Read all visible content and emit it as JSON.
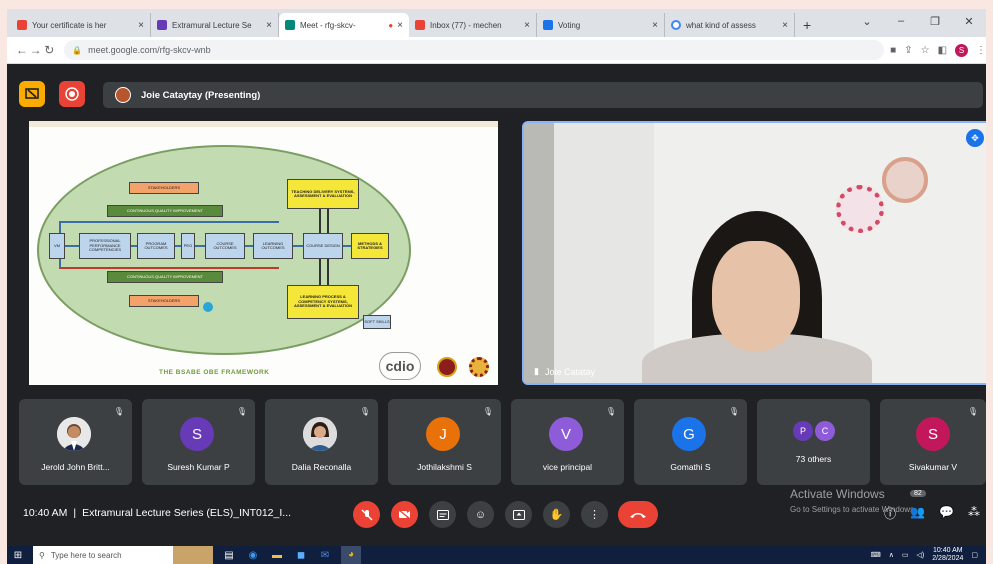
{
  "tabs": [
    {
      "label": "Your certificate is her",
      "favicon_color": "#ea4335",
      "active": false
    },
    {
      "label": "Extramural Lecture Se",
      "favicon_color": "#673ab7",
      "active": false
    },
    {
      "label": "Meet - rfg-skcv-",
      "favicon_color": "#00897b",
      "active": true
    },
    {
      "label": "Inbox (77) - mechen",
      "favicon_color": "#ea4335",
      "active": false
    },
    {
      "label": "Voting",
      "favicon_color": "#1a73e8",
      "active": false
    },
    {
      "label": "what kind of assess",
      "favicon_color": "#4285f4",
      "active": false
    }
  ],
  "address": {
    "url": "meet.google.com/rfg-skcv-wnb",
    "profile_initial": "S"
  },
  "meet": {
    "presenting_label": "Joie Cataytay (Presenting)",
    "self_name": "Joie Catatay"
  },
  "slide": {
    "title": "THE BSABE OBE FRAMEWORK",
    "logo": "cdio",
    "boxes": {
      "stakeholders_top": "STAKEHOLDERS",
      "cqi_top": "CONTINUOUS QUALITY IMPROVEMENT",
      "cqi_bottom": "CONTINUOUS QUALITY IMPROVEMENT",
      "stakeholders_bottom": "STAKEHOLDERS",
      "teaching": "TEACHING DELIVERY SYSTEMS, ASSESSMENT & EVALUATION",
      "learning": "LEARNING PROCESS & COMPETENCY SYSTEMS, ASSESSMENT & EVALUATION",
      "engineering": "PROFESSIONAL PERFORMANCE COMPETENCIES",
      "program": "PROGRAM OUTCOMES",
      "course": "COURSE OUTCOMES",
      "learning_out": "LEARNING OUTCOMES",
      "design": "COURSE DESIGN",
      "methods": "METHODS & STRATEGIES",
      "vmg": "VM",
      "peo": "PEO",
      "skills": "SOFT SKILLS"
    }
  },
  "participants": [
    {
      "name": "Jerold John Britt...",
      "initial": "",
      "color": "#5f6368",
      "photo": true
    },
    {
      "name": "Suresh Kumar P",
      "initial": "S",
      "color": "#673ab7",
      "photo": false
    },
    {
      "name": "Dalia Reconalla",
      "initial": "",
      "color": "#5f6368",
      "photo": true
    },
    {
      "name": "Jothilakshmi S",
      "initial": "J",
      "color": "#e8710a",
      "photo": false
    },
    {
      "name": "vice principal",
      "initial": "V",
      "color": "#8e5cd9",
      "photo": false
    },
    {
      "name": "Gomathi S",
      "initial": "G",
      "color": "#1a73e8",
      "photo": false
    },
    {
      "name": "73 others",
      "initial": "",
      "color": "#5f6368",
      "photo": false,
      "others": [
        "P",
        "C"
      ]
    },
    {
      "name": "Sivakumar V",
      "initial": "S",
      "color": "#c2185b",
      "photo": false
    }
  ],
  "bottom": {
    "time": "10:40 AM",
    "separator": "|",
    "meeting_title": "Extramural Lecture Series (ELS)_INT012_I...",
    "people_count": "82",
    "activate_title": "Activate Windows",
    "activate_sub": "Go to Settings to activate Windows."
  },
  "taskbar": {
    "search_placeholder": "Type here to search",
    "clock_time": "10:40 AM",
    "clock_date": "2/28/2024"
  }
}
